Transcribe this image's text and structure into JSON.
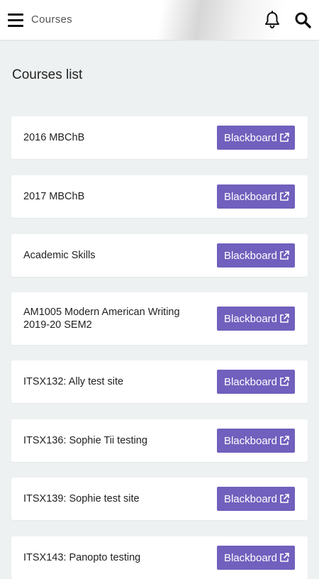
{
  "header": {
    "title": "Courses",
    "icons": {
      "menu": "hamburger-menu-icon",
      "notifications": "bell-icon",
      "search": "search-icon"
    }
  },
  "page": {
    "title": "Courses list"
  },
  "courses": [
    {
      "name": "2016 MBChB",
      "button_label": "Blackboard"
    },
    {
      "name": "2017 MBChB",
      "button_label": "Blackboard"
    },
    {
      "name": "Academic Skills",
      "button_label": "Blackboard"
    },
    {
      "name": "AM1005 Modern American Writing 2019-20 SEM2",
      "button_label": "Blackboard"
    },
    {
      "name": "ITSX132: Ally test site",
      "button_label": "Blackboard"
    },
    {
      "name": "ITSX136: Sophie Tii testing",
      "button_label": "Blackboard"
    },
    {
      "name": "ITSX139: Sophie test site",
      "button_label": "Blackboard"
    },
    {
      "name": "ITSX143: Panopto testing",
      "button_label": "Blackboard"
    }
  ],
  "colors": {
    "accent": "#7160bd",
    "background": "#eef1f1",
    "card": "#ffffff"
  }
}
